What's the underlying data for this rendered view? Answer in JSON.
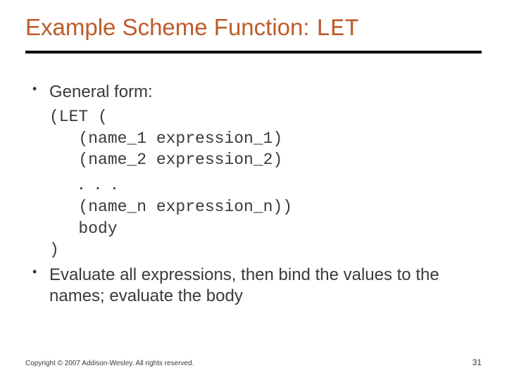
{
  "title": {
    "prefix": "Example Scheme Function: ",
    "mono": "LET"
  },
  "bullets": {
    "b1": "General form:",
    "b2": "Evaluate all expressions, then bind the values to the names; evaluate the body"
  },
  "code": {
    "l1": "(LET (",
    "l2": "   (name_1 expression_1)",
    "l3": "   (name_2 expression_2)",
    "l4pre": "   ",
    "l4dots": ". . .",
    "l5": "   (name_n expression_n))",
    "l6": "   body",
    "l7": ")"
  },
  "footer": {
    "copyright": "Copyright © 2007 Addison-Wesley. All rights reserved.",
    "page": "31"
  }
}
